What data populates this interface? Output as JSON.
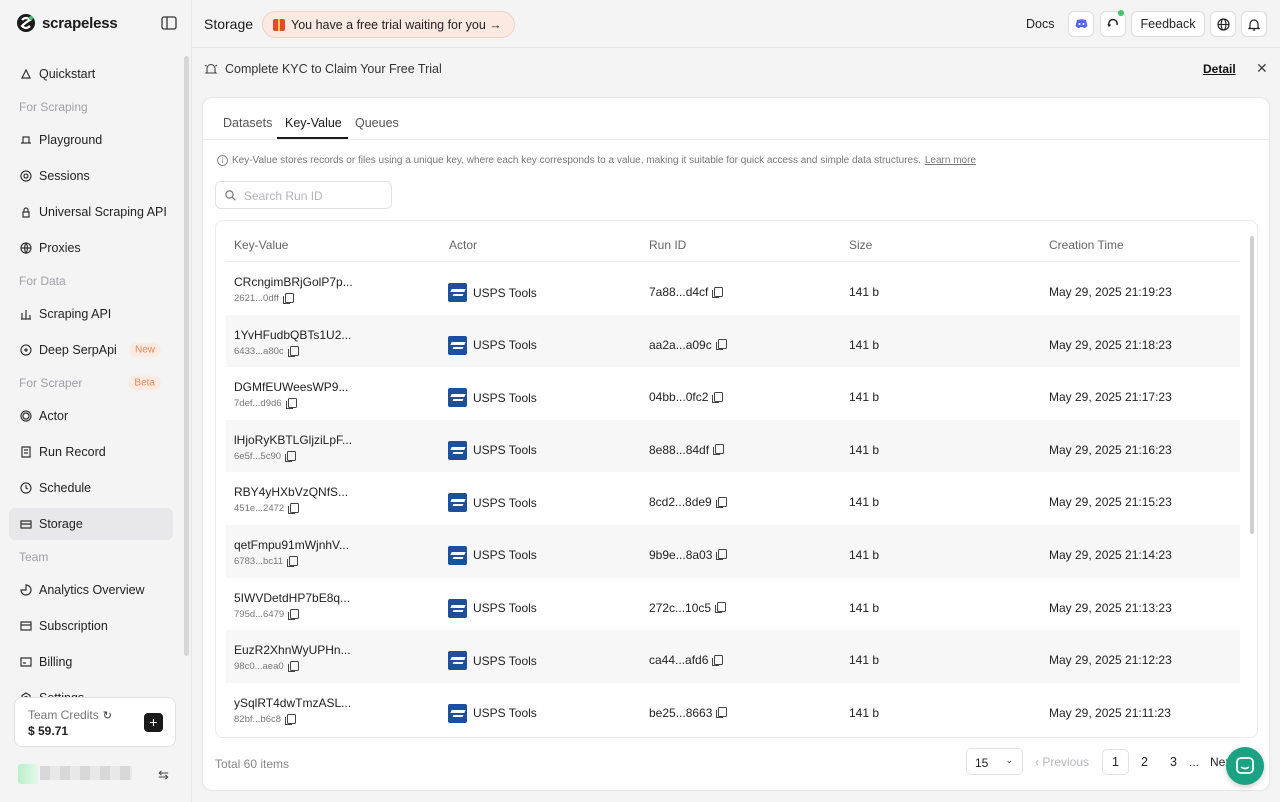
{
  "brand": {
    "name": "scrapeless"
  },
  "sidebar": {
    "items": [
      {
        "type": "item",
        "label": "Quickstart",
        "icon": "rocket-icon"
      },
      {
        "type": "section",
        "label": "For Scraping"
      },
      {
        "type": "item",
        "label": "Playground",
        "icon": "playground-icon"
      },
      {
        "type": "item",
        "label": "Sessions",
        "icon": "sessions-icon"
      },
      {
        "type": "item",
        "label": "Universal Scraping API",
        "icon": "lock-icon"
      },
      {
        "type": "item",
        "label": "Proxies",
        "icon": "globe-icon"
      },
      {
        "type": "section",
        "label": "For Data"
      },
      {
        "type": "item",
        "label": "Scraping API",
        "icon": "api-icon"
      },
      {
        "type": "item",
        "label": "Deep SerpApi",
        "icon": "serp-icon",
        "tag": "New"
      },
      {
        "type": "section",
        "label": "For Scraper",
        "tag": "Beta"
      },
      {
        "type": "item",
        "label": "Actor",
        "icon": "actor-icon"
      },
      {
        "type": "item",
        "label": "Run Record",
        "icon": "record-icon"
      },
      {
        "type": "item",
        "label": "Schedule",
        "icon": "clock-icon"
      },
      {
        "type": "item",
        "label": "Storage",
        "icon": "storage-icon",
        "active": true
      },
      {
        "type": "section",
        "label": "Team"
      },
      {
        "type": "item",
        "label": "Analytics Overview",
        "icon": "analytics-icon"
      },
      {
        "type": "item",
        "label": "Subscription",
        "icon": "subscription-icon"
      },
      {
        "type": "item",
        "label": "Billing",
        "icon": "billing-icon"
      },
      {
        "type": "item",
        "label": "Settings",
        "icon": "settings-icon"
      }
    ],
    "credits_label": "Team Credits",
    "credits_value": "$ 59.71"
  },
  "header": {
    "title": "Storage",
    "trial_text": "You have a free trial waiting for you →",
    "docs": "Docs",
    "feedback": "Feedback"
  },
  "kyc": {
    "text": "Complete KYC to Claim Your Free Trial",
    "detail": "Detail"
  },
  "tabs": [
    "Datasets",
    "Key-Value",
    "Queues"
  ],
  "info": {
    "text": "Key-Value stores records or files using a unique key, where each key corresponds to a value, making it suitable for quick access and simple data structures.",
    "link": "Learn more"
  },
  "search": {
    "placeholder": "Search Run ID"
  },
  "table": {
    "columns": [
      "Key-Value",
      "Actor",
      "Run ID",
      "Size",
      "Creation Time"
    ],
    "rows": [
      {
        "key": "CRcngimBRjGolP7p...",
        "sub": "2621...0dff",
        "actor": "USPS Tools",
        "run_id": "7a88...d4cf",
        "size": "141 b",
        "time": "May 29, 2025 21:19:23"
      },
      {
        "key": "1YvHFudbQBTs1U2...",
        "sub": "6433...a80c",
        "actor": "USPS Tools",
        "run_id": "aa2a...a09c",
        "size": "141 b",
        "time": "May 29, 2025 21:18:23"
      },
      {
        "key": "DGMfEUWeesWP9...",
        "sub": "7def...d9d6",
        "actor": "USPS Tools",
        "run_id": "04bb...0fc2",
        "size": "141 b",
        "time": "May 29, 2025 21:17:23"
      },
      {
        "key": "lHjoRyKBTLGljziLpF...",
        "sub": "6e5f...5c90",
        "actor": "USPS Tools",
        "run_id": "8e88...84df",
        "size": "141 b",
        "time": "May 29, 2025 21:16:23"
      },
      {
        "key": "RBY4yHXbVzQNfS...",
        "sub": "451e...2472",
        "actor": "USPS Tools",
        "run_id": "8cd2...8de9",
        "size": "141 b",
        "time": "May 29, 2025 21:15:23"
      },
      {
        "key": "qetFmpu91mWjnhV...",
        "sub": "6783...bc11",
        "actor": "USPS Tools",
        "run_id": "9b9e...8a03",
        "size": "141 b",
        "time": "May 29, 2025 21:14:23"
      },
      {
        "key": "5IWVDetdHP7bE8q...",
        "sub": "795d...6479",
        "actor": "USPS Tools",
        "run_id": "272c...10c5",
        "size": "141 b",
        "time": "May 29, 2025 21:13:23"
      },
      {
        "key": "EuzR2XhnWyUPHn...",
        "sub": "98c0...aea0",
        "actor": "USPS Tools",
        "run_id": "ca44...afd6",
        "size": "141 b",
        "time": "May 29, 2025 21:12:23"
      },
      {
        "key": "ySqlRT4dwTmzASL...",
        "sub": "82bf...b6c8",
        "actor": "USPS Tools",
        "run_id": "be25...8663",
        "size": "141 b",
        "time": "May 29, 2025 21:11:23"
      }
    ]
  },
  "pagination": {
    "total": "Total 60 items",
    "page_size": "15",
    "previous": "Previous",
    "pages": [
      "1",
      "2",
      "3"
    ],
    "ellipsis": "...",
    "next": "Next",
    "current": "1"
  }
}
